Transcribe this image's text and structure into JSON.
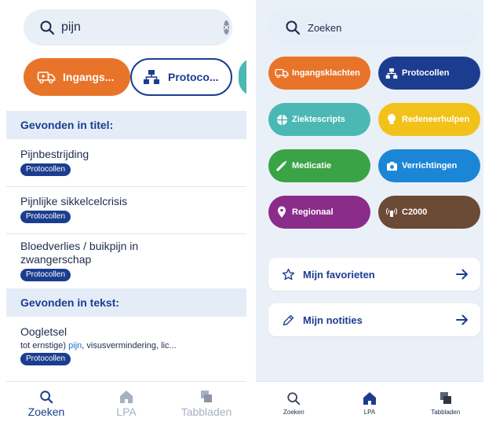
{
  "left": {
    "search": {
      "value": "pijn"
    },
    "chips": [
      {
        "label": "Ingangs...",
        "color": "#e8742a",
        "icon": "ambulance-icon"
      },
      {
        "label": "Protoco...",
        "color": "#1c3d8f",
        "icon": "hierarchy-icon"
      }
    ],
    "sections": {
      "title_label": "Gevonden in titel:",
      "text_label": "Gevonden in tekst:"
    },
    "title_results": [
      {
        "title": "Pijnbestrijding",
        "badge": "Protocollen"
      },
      {
        "title": "Pijnlijke sikkelcelcrisis",
        "badge": "Protocollen"
      },
      {
        "title": "Bloedverlies / buikpijn in zwangerschap",
        "badge": "Protocollen"
      }
    ],
    "text_results": [
      {
        "title": "Oogletsel",
        "snippet_before": "tot ernstige) ",
        "snippet_highlight": "pijn",
        "snippet_after": ", visusvermindering, lic...",
        "badge": "Protocollen"
      }
    ],
    "tabs": [
      {
        "label": "Zoeken",
        "icon": "search-icon",
        "active": true
      },
      {
        "label": "LPA",
        "icon": "home-icon",
        "active": false
      },
      {
        "label": "Tabbladen",
        "icon": "tabs-icon",
        "active": false
      }
    ]
  },
  "right": {
    "search": {
      "placeholder": "Zoeken"
    },
    "tiles": [
      {
        "label": "Ingangsklachten",
        "color": "#e8742a",
        "icon": "ambulance-icon"
      },
      {
        "label": "Protocollen",
        "color": "#1c3d8f",
        "icon": "hierarchy-icon"
      },
      {
        "label": "Ziektescripts",
        "color": "#4bb8b4",
        "icon": "globe-icon"
      },
      {
        "label": "Redeneerhulpen",
        "color": "#f2c21b",
        "icon": "lightbulb-icon"
      },
      {
        "label": "Medicatie",
        "color": "#3aa346",
        "icon": "syringe-icon"
      },
      {
        "label": "Verrichtingen",
        "color": "#1b86d6",
        "icon": "camera-icon"
      },
      {
        "label": "Regionaal",
        "color": "#8a2d8a",
        "icon": "map-pin-icon"
      },
      {
        "label": "C2000",
        "color": "#6b4a36",
        "icon": "radio-icon"
      }
    ],
    "cards": [
      {
        "label": "Mijn favorieten",
        "icon": "star-icon"
      },
      {
        "label": "Mijn notities",
        "icon": "pencil-icon"
      }
    ],
    "tabs": [
      {
        "label": "Zoeken",
        "icon": "search-icon"
      },
      {
        "label": "LPA",
        "icon": "home-icon"
      },
      {
        "label": "Tabbladen",
        "icon": "tabs-icon"
      }
    ]
  },
  "colors": {
    "brand": "#1c3d8f",
    "link_highlight": "#1b6fd8",
    "section_bg": "#e4edf7",
    "inactive_tab": "#a6b0c3"
  }
}
